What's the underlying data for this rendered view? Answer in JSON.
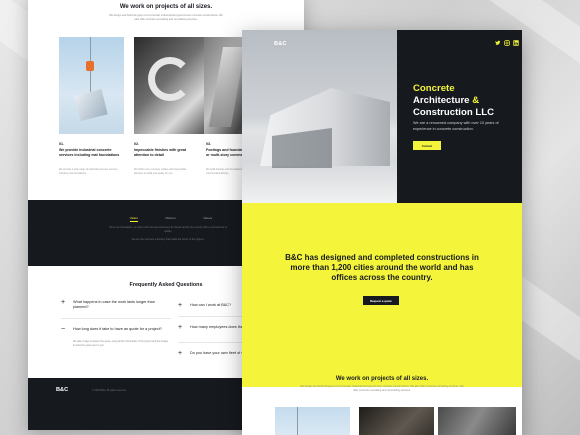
{
  "brand": {
    "logo": "B&C",
    "accent": "#f4f53a",
    "dark": "#16191e"
  },
  "front": {
    "social_icons": [
      "twitter-icon",
      "instagram-icon",
      "linkedin-icon"
    ],
    "hero": {
      "title_line1": "Concrete",
      "title_line2a": "Architecture",
      "title_line2b": "&",
      "title_line3": "Construction LLC",
      "description": "We are a renowned company with over 10 years of experience in concrete construction.",
      "button_label": "Contact"
    },
    "about": {
      "title": "B&C has designed and completed constructions in more than 1,200 cities around the world and has offices across the country.",
      "button_label": "Request a quote"
    },
    "work": {
      "title": "We work on projects of all sizes.",
      "text": "We design and build all types of commercial, industrial and government concrete constructions. We also offer concrete consulting services. We offer concrete consulting and remodeling services."
    }
  },
  "back": {
    "intro_title": "We work on projects of all sizes.",
    "intro_text": "We design and build all types of commercial, industrial and government concrete constructions. We also offer concrete consulting and remodeling services.",
    "services": [
      {
        "num": "01.",
        "title": "We provide industrial concrete services including mat foundations",
        "desc": "We provide a wide range of industrial concrete services including mat foundations."
      },
      {
        "num": "02.",
        "title": "Impeccable finishes with great attention to detail",
        "desc": "We finish every concrete surface with impeccable attention to detail and quality for you."
      },
      {
        "num": "03.",
        "title": "Footings and foundations for single or multi-story commercial buildings",
        "desc": "We build footings and foundations for single or multi-story commercial buildings."
      }
    ],
    "stats": {
      "tabs": [
        "Vision",
        "Mission",
        "Values"
      ],
      "text_1": "Since our foundation, we have built concrete structures for clients across the country with a commitment to quality.",
      "text_2": "We are the concrete company that builds the future of the project."
    },
    "faq": {
      "title": "Frequently Asked Questions",
      "items": [
        {
          "sign": "+",
          "q": "What happens in case the work lasts longer than planned?",
          "a": ""
        },
        {
          "sign": "−",
          "q": "How long does it take to have an quote for a project?",
          "a": "We take 3 days to deliver the quote, using all the information of the project and the budget to draw the quote sent to you."
        },
        {
          "sign": "+",
          "q": "How can I work at B&C?",
          "a": ""
        },
        {
          "sign": "+",
          "q": "How many employees does the company have?",
          "a": ""
        },
        {
          "sign": "+",
          "q": "Do you have your own fleet of vehicles?",
          "a": ""
        }
      ]
    },
    "footer": {
      "logo": "B&C",
      "copyright": "© 2022 B&C. All rights reserved."
    }
  }
}
